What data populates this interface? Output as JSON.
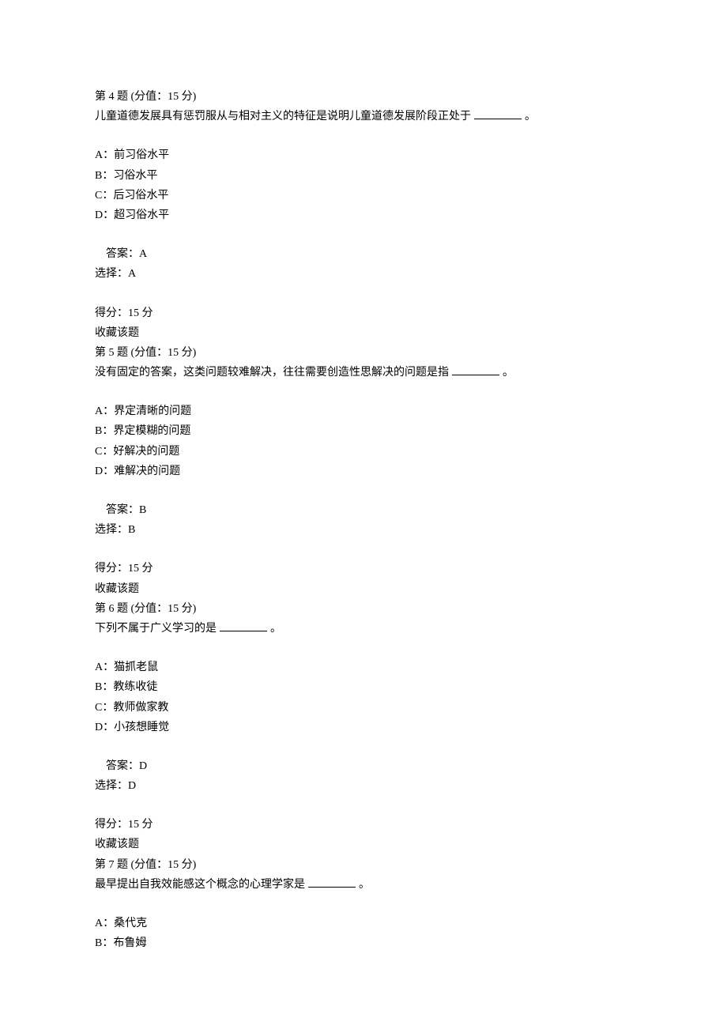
{
  "questions": [
    {
      "header": "第 4 题 (分值：15 分)",
      "stem": "儿童道德发展具有惩罚服从与相对主义的特征是说明儿童道德发展阶段正处于",
      "period": "。",
      "options": {
        "a": "A：前习俗水平",
        "b": "B：习俗水平",
        "c": "C：后习俗水平",
        "d": "D：超习俗水平"
      },
      "answer_label": "答案：A",
      "choice_label": "选择：A",
      "score_label": "得分：15 分",
      "fav_label": "收藏该题"
    },
    {
      "header": "第 5 题 (分值：15 分)",
      "stem": "没有固定的答案，这类问题较难解决，往往需要创造性思解决的问题是指",
      "period": "。",
      "options": {
        "a": "A：界定清晰的问题",
        "b": "B：界定模糊的问题",
        "c": "C：好解决的问题",
        "d": "D：难解决的问题"
      },
      "answer_label": "答案：B",
      "choice_label": "选择：B",
      "score_label": "得分：15 分",
      "fav_label": "收藏该题"
    },
    {
      "header": "第 6 题 (分值：15 分)",
      "stem": "下列不属于广义学习的是",
      "period": "。",
      "options": {
        "a": "A：猫抓老鼠",
        "b": "B：教练收徒",
        "c": "C：教师做家教",
        "d": "D：小孩想睡觉"
      },
      "answer_label": "答案：D",
      "choice_label": "选择：D",
      "score_label": "得分：15 分",
      "fav_label": "收藏该题"
    },
    {
      "header": "第 7 题 (分值：15 分)",
      "stem": "最早提出自我效能感这个概念的心理学家是",
      "period": "。",
      "options": {
        "a": "A：桑代克",
        "b": "B：布鲁姆"
      }
    }
  ]
}
